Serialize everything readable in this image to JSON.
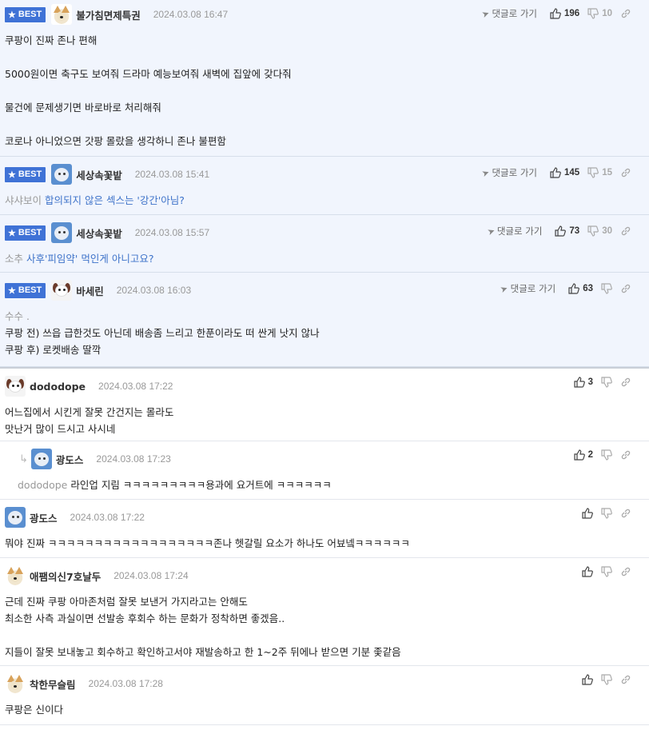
{
  "ui": {
    "best_label": "BEST",
    "reply_go_label": "댓글로 가기",
    "empty": ""
  },
  "comments": [
    {
      "nick": "불가침면제특권",
      "date": "2024.03.08 16:47",
      "up": "196",
      "down": "10",
      "lines": [
        "쿠팡이 진짜 존나 편해",
        "",
        "5000원이면 축구도 보여줘 드라마 예능보여줘 새벽에 집앞에 갖다줘",
        "",
        "물건에 문제생기면 바로바로 처리해줘",
        "",
        "코로나 아니었으면 갓팡 몰랐을 생각하니 존나 불편함"
      ]
    },
    {
      "nick": "세상속꽃밭",
      "date": "2024.03.08 15:41",
      "up": "145",
      "down": "15",
      "quote": "샤샤보이",
      "text": "합의되지 않은 섹스는 '강간'아님?"
    },
    {
      "nick": "세상속꽃밭",
      "date": "2024.03.08 15:57",
      "up": "73",
      "down": "30",
      "quote": "소추",
      "text": "사후'피임약' 먹인게 아니고요?"
    },
    {
      "nick": "바세린",
      "date": "2024.03.08 16:03",
      "up": "63",
      "quote": "수수 .",
      "lines": [
        "쿠팡 전) 쓰읍 급한것도 아닌데 배송좀 느리고 한푼이라도 떠 싼게 낫지 않나",
        "쿠팡 후) 로켓배송 딸깍"
      ]
    },
    {
      "nick": "dododope",
      "date": "2024.03.08 17:22",
      "up": "3",
      "lines": [
        "어느집에서 시킨게 잘못 간건지는 몰라도",
        "맛난거 많이 드시고 사시네"
      ]
    },
    {
      "nick": "광도스",
      "date": "2024.03.08 17:23",
      "up": "2",
      "quote": "dododope",
      "text": "라인업 지림 ㅋㅋㅋㅋㅋㅋㅋㅋㅋ용과에 요거트에 ㅋㅋㅋㅋㅋㅋ"
    },
    {
      "nick": "광도스",
      "date": "2024.03.08 17:22",
      "text": "뭐야 진짜 ㅋㅋㅋㅋㅋㅋㅋㅋㅋㅋㅋㅋㅋㅋㅋㅋㅋㅋ존나 헷갈릴 요소가 하나도 어뵤넼ㅋㅋㅋㅋㅋㅋ"
    },
    {
      "nick": "애팸의신7호날두",
      "date": "2024.03.08 17:24",
      "lines": [
        "근데 진짜 쿠팡 아마존처럼 잘못 보낸거 가지라고는 안해도",
        "최소한 사측 과실이면 선발송 후회수 하는 문화가 정착하면 좋겠음..",
        "",
        "지들이 잘못 보내놓고 회수하고 확인하고서야 재발송하고 한 1~2주 뒤에나 받으면 기분 좇같음"
      ]
    },
    {
      "nick": "착한무슬림",
      "date": "2024.03.08 17:28",
      "text": "쿠팡은 신이다"
    }
  ],
  "icons": [
    "star-icon",
    "reply-plane-icon",
    "thumb-up-icon",
    "thumb-down-icon",
    "link-icon",
    "reply-arrow-icon"
  ]
}
